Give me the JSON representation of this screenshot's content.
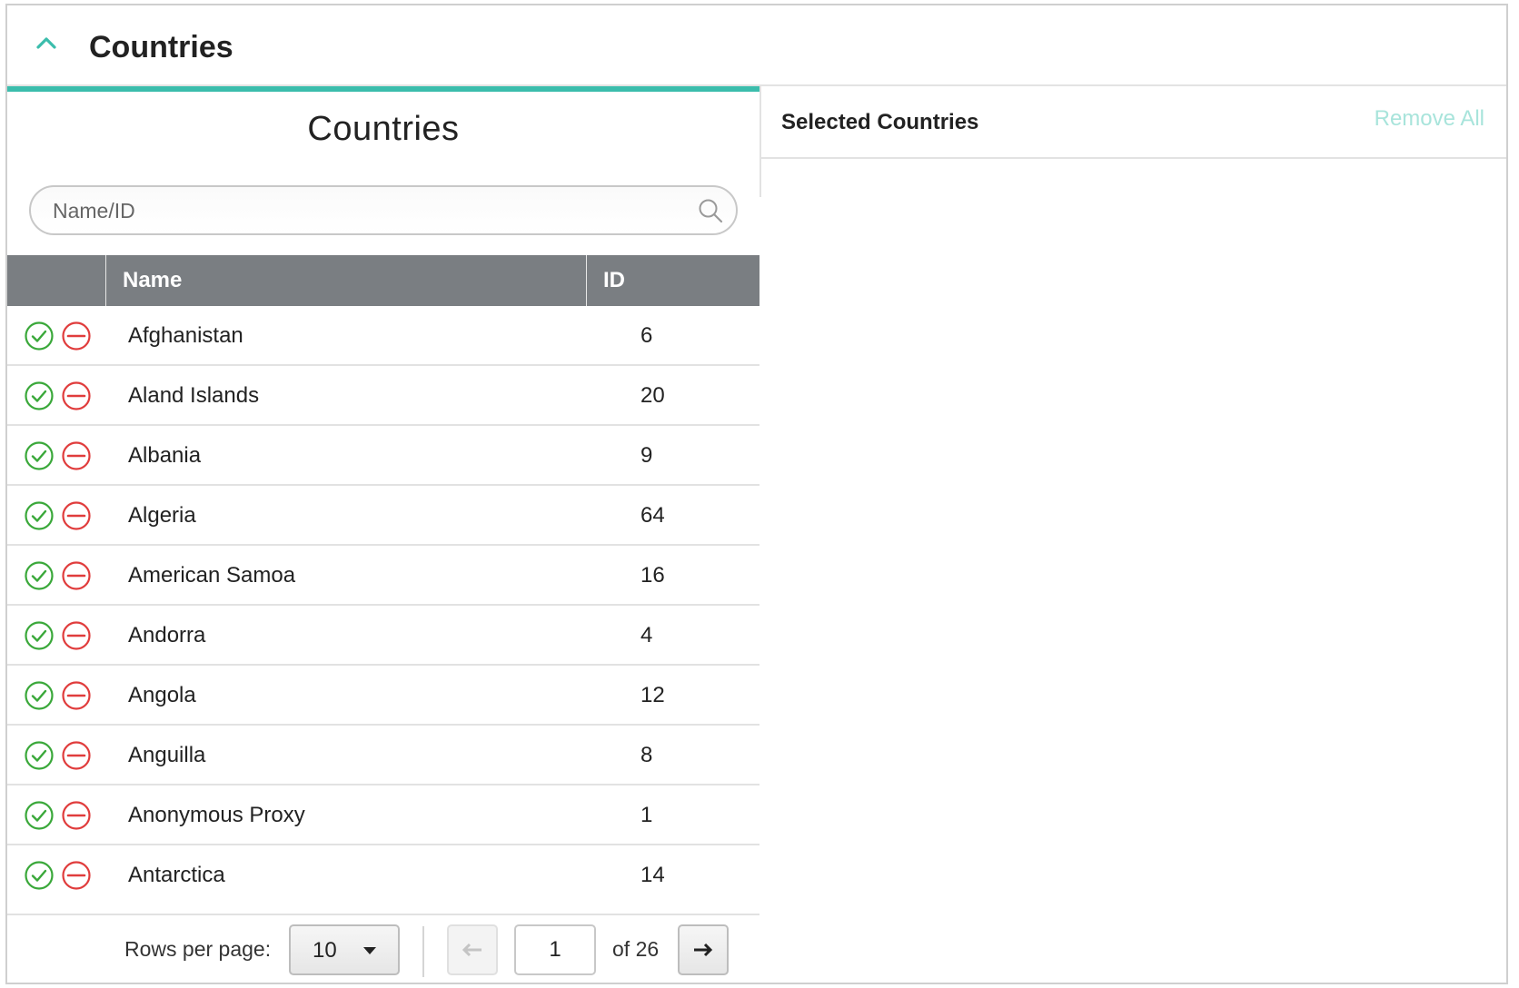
{
  "header": {
    "title": "Countries"
  },
  "left": {
    "title": "Countries",
    "search": {
      "placeholder": "Name/ID",
      "value": ""
    },
    "columns": {
      "actions": "",
      "name": "Name",
      "id": "ID"
    },
    "rows": [
      {
        "name": "Afghanistan",
        "id": "6"
      },
      {
        "name": "Aland Islands",
        "id": "20"
      },
      {
        "name": "Albania",
        "id": "9"
      },
      {
        "name": "Algeria",
        "id": "64"
      },
      {
        "name": "American Samoa",
        "id": "16"
      },
      {
        "name": "Andorra",
        "id": "4"
      },
      {
        "name": "Angola",
        "id": "12"
      },
      {
        "name": "Anguilla",
        "id": "8"
      },
      {
        "name": "Anonymous Proxy",
        "id": "1"
      },
      {
        "name": "Antarctica",
        "id": "14"
      }
    ]
  },
  "pagination": {
    "rows_per_page_label": "Rows per page:",
    "rows_per_page_value": "10",
    "page_value": "1",
    "of_label": "of 26"
  },
  "right": {
    "title": "Selected Countries",
    "remove_all_label": "Remove All"
  },
  "colors": {
    "accent": "#3bbdac",
    "include": "#3aa83a",
    "exclude": "#e03c3c",
    "table_header": "#7a7e82",
    "remove_all_disabled": "#a8e4db"
  },
  "icons": {
    "collapse": "chevron-up-icon",
    "search": "search-icon",
    "include": "check-circle-icon",
    "exclude": "minus-circle-icon",
    "prev": "arrow-left-icon",
    "next": "arrow-right-icon",
    "dropdown": "caret-down-icon"
  }
}
